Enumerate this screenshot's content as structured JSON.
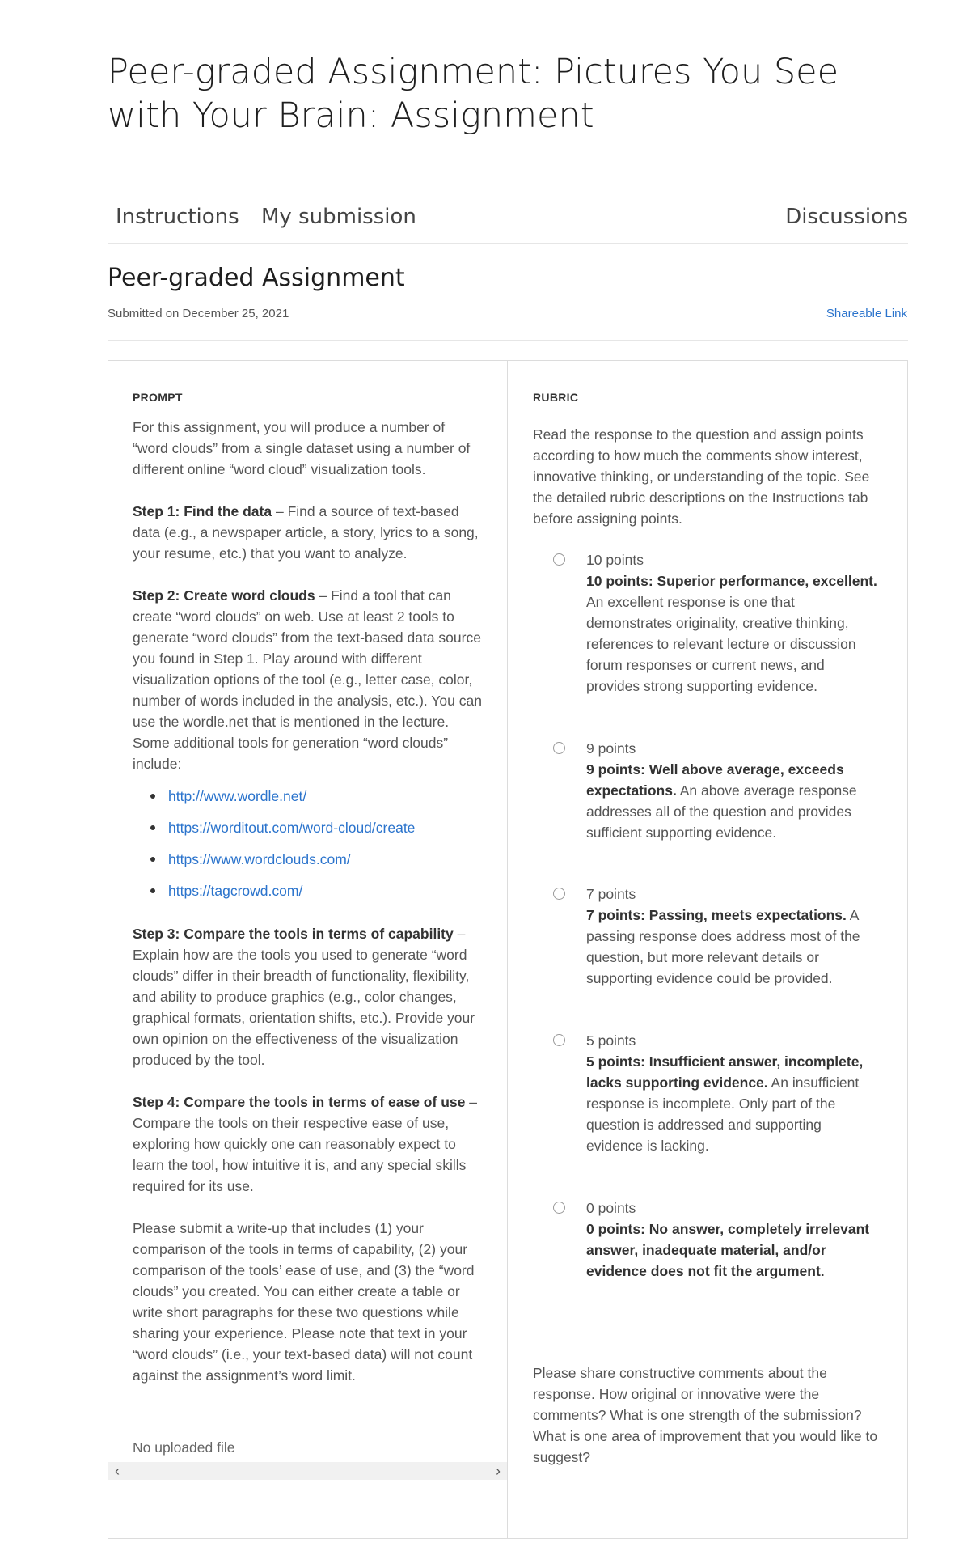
{
  "title": "Peer-graded Assignment: Pictures You See with Your Brain: Assignment",
  "tabs": {
    "instructions": "Instructions",
    "submission": "My submission",
    "discussions": "Discussions"
  },
  "header": {
    "subtitle": "Peer-graded Assignment",
    "submitted": "Submitted on December 25, 2021",
    "share_link": "Shareable Link"
  },
  "prompt": {
    "label": "PROMPT",
    "intro": "For this assignment, you will produce a number of “word clouds” from a single dataset using a number of different online “word cloud” visualization tools.",
    "step1_title": "Step 1: Find the data",
    "step1_text": " – Find a source of text-based data (e.g., a newspaper article, a story, lyrics to a song, your resume, etc.) that you want to analyze.",
    "step2_title": "Step 2: Create word clouds",
    "step2_text": " – Find a tool that can create “word clouds” on web. Use at least 2 tools to generate “word clouds” from the text-based data source you found in Step 1. Play around with different visualization options of the tool (e.g., letter case, color, number of words included in the analysis, etc.). You can use the wordle.net that is mentioned in the lecture. Some additional tools for generation “word clouds” include:",
    "links": [
      "http://www.wordle.net/",
      "https://worditout.com/word-cloud/create",
      "https://www.wordclouds.com/",
      "https://tagcrowd.com/"
    ],
    "step3_title": "Step 3: Compare the tools in terms of capability",
    "step3_text": " – Explain how are the tools you used to generate “word clouds” differ in their breadth of functionality, flexibility, and ability to produce graphics (e.g., color changes, graphical formats, orientation shifts, etc.). Provide your own opinion on the effectiveness of the visualization produced by the tool.",
    "step4_title": "Step 4: Compare the tools in terms of ease of use",
    "step4_text": " – Compare the tools on their respective ease of use, exploring how quickly one can reasonably expect to learn the tool, how intuitive it is, and any special skills required for its use.",
    "submit_text": "Please submit a write-up that includes (1) your comparison of the tools in terms of capability, (2) your comparison of the tools’ ease of use, and (3) the “word clouds” you created. You can either create a table or write short paragraphs for these two questions while sharing your experience. Please note that text in your “word clouds” (i.e., your text-based data) will not count against the assignment’s word limit.",
    "no_file": "No uploaded file"
  },
  "rubric": {
    "label": "RUBRIC",
    "intro": "Read the response to the question and assign points according to how much the comments show interest, innovative thinking, or understanding of the topic. See the detailed rubric descriptions on the Instructions tab before assigning points.",
    "options": [
      {
        "label": "10 points",
        "bold": "10 points: Superior performance, excellent.",
        "text": " An excellent response is one that demonstrates originality, creative thinking, references to relevant lecture or discussion forum responses or current news, and provides strong supporting evidence."
      },
      {
        "label": "9 points",
        "bold": "9 points: Well above average, exceeds expectations.",
        "text": " An above average response addresses all of the question and provides sufficient supporting evidence."
      },
      {
        "label": "7 points",
        "bold": "7 points: Passing, meets expectations.",
        "text": " A passing response does address most of the question, but more relevant details or supporting evidence could be provided."
      },
      {
        "label": "5 points",
        "bold": "5 points: Insufficient answer, incomplete, lacks supporting evidence.",
        "text": " An insufficient response is incomplete. Only part of the question is addressed and supporting evidence is lacking."
      },
      {
        "label": "0 points",
        "bold": "0 points: No answer, completely irrelevant answer, inadequate material, and/or evidence does not fit the argument.",
        "text": ""
      }
    ],
    "comments": "Please share constructive comments about the response. How original or innovative were the comments? What is one strength of the submission? What is one area of improvement that you would like to suggest?"
  },
  "icons": {
    "scroll_left": "chevron-left-icon",
    "scroll_right": "chevron-right-icon"
  }
}
